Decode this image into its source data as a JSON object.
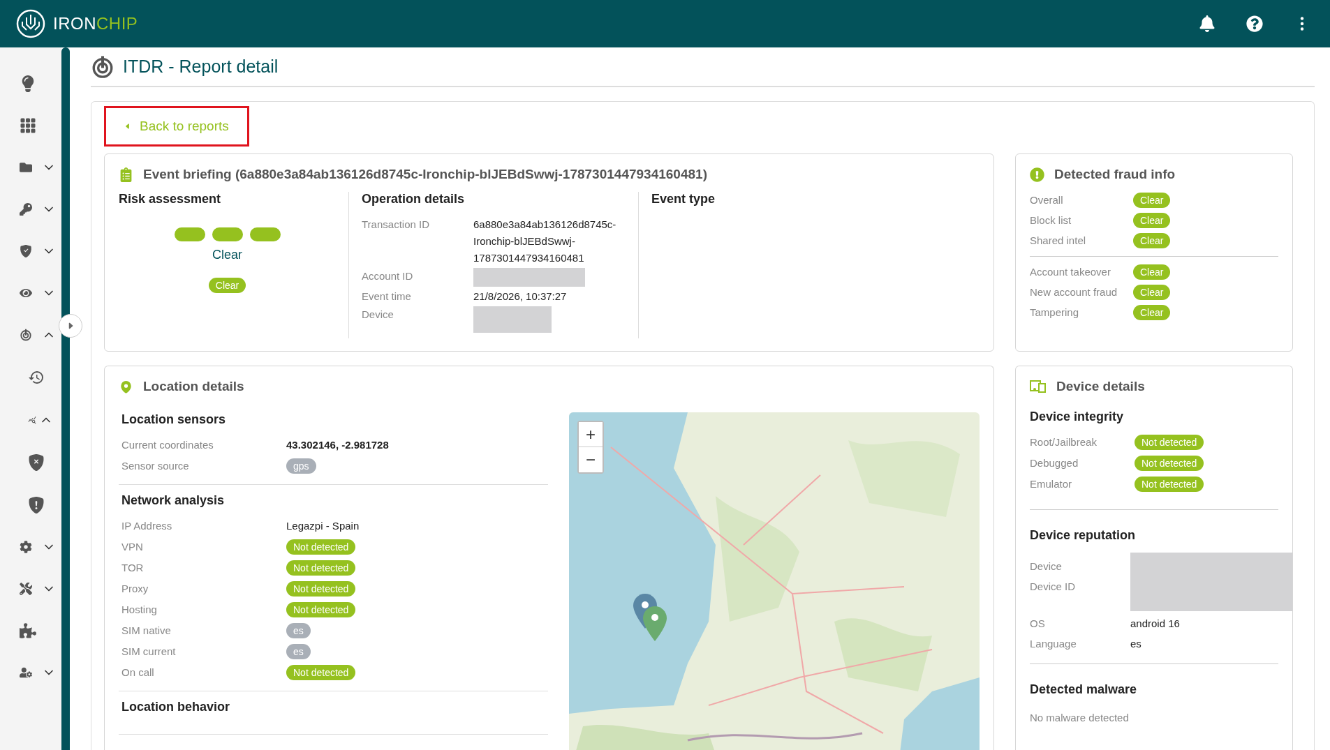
{
  "header": {
    "brand": "IRON",
    "brand_accent": "CHIP"
  },
  "sidebar": {
    "items": [
      {
        "kind": "link"
      },
      {
        "kind": "link"
      },
      {
        "kind": "group",
        "expanded": false
      },
      {
        "kind": "group",
        "expanded": false
      },
      {
        "kind": "group",
        "expanded": false
      },
      {
        "kind": "group",
        "expanded": false
      },
      {
        "kind": "group",
        "expanded": true,
        "children": [
          {
            "kind": "link"
          },
          {
            "kind": "group",
            "expanded": true
          },
          {
            "kind": "link"
          },
          {
            "kind": "link"
          }
        ]
      },
      {
        "kind": "group",
        "expanded": false
      },
      {
        "kind": "group",
        "expanded": false
      },
      {
        "kind": "link"
      },
      {
        "kind": "group",
        "expanded": false
      }
    ]
  },
  "page": {
    "title": "ITDR - Report detail",
    "back_link": "Back to reports"
  },
  "event_briefing": {
    "title": "Event briefing (6a880e3a84ab136126d8745c-Ironchip-blJEBdSwwj-1787301447934160481)",
    "risk": {
      "heading": "Risk assessment",
      "levels": [
        {
          "on": true
        },
        {
          "on": true
        },
        {
          "on": true
        }
      ],
      "level_label": "Clear",
      "badge": "Clear"
    },
    "operation": {
      "heading": "Operation details",
      "rows": [
        {
          "label": "Transaction ID",
          "value": "6a880e3a84ab136126d8745c-Ironchip-blJEBdSwwj-1787301447934160481"
        },
        {
          "label": "Account ID",
          "redacted": true
        },
        {
          "label": "Event time",
          "value": "21/8/2026, 10:37:27"
        },
        {
          "label": "Device",
          "redacted": true
        }
      ]
    },
    "event_type": {
      "heading": "Event type"
    }
  },
  "fraud_info": {
    "title": "Detected fraud info",
    "groups": [
      [
        {
          "label": "Overall",
          "badge": "Clear"
        },
        {
          "label": "Block list",
          "badge": "Clear"
        },
        {
          "label": "Shared intel",
          "badge": "Clear"
        }
      ],
      [
        {
          "label": "Account takeover",
          "badge": "Clear"
        },
        {
          "label": "New account fraud",
          "badge": "Clear"
        },
        {
          "label": "Tampering",
          "badge": "Clear"
        }
      ]
    ]
  },
  "location": {
    "title": "Location details",
    "sections": [
      {
        "heading": "Location sensors",
        "rows": [
          {
            "label": "Current coordinates",
            "kind": "strong",
            "value": "43.302146, -2.981728"
          },
          {
            "label": "Sensor source",
            "kind": "neutral",
            "value": "gps"
          }
        ]
      },
      {
        "heading": "Network analysis",
        "rows": [
          {
            "label": "IP Address",
            "kind": "text",
            "value": "Legazpi - Spain"
          },
          {
            "label": "VPN",
            "kind": "ok",
            "value": "Not detected"
          },
          {
            "label": "TOR",
            "kind": "ok",
            "value": "Not detected"
          },
          {
            "label": "Proxy",
            "kind": "ok",
            "value": "Not detected"
          },
          {
            "label": "Hosting",
            "kind": "ok",
            "value": "Not detected"
          },
          {
            "label": "SIM native",
            "kind": "neutral",
            "value": "es"
          },
          {
            "label": "SIM current",
            "kind": "neutral",
            "value": "es"
          },
          {
            "label": "On call",
            "kind": "ok",
            "value": "Not detected"
          }
        ]
      },
      {
        "heading": "Location behavior"
      }
    ],
    "map": {
      "kind": "picture",
      "zoom_in": "+",
      "zoom_out": "−",
      "markers": [
        {
          "color": "#5a87a5"
        },
        {
          "color": "#6aab6e"
        }
      ]
    }
  },
  "device": {
    "title": "Device details",
    "integrity": {
      "heading": "Device integrity",
      "rows": [
        {
          "label": "Root/Jailbreak",
          "badge": "Not detected"
        },
        {
          "label": "Debugged",
          "badge": "Not detected"
        },
        {
          "label": "Emulator",
          "badge": "Not detected"
        }
      ]
    },
    "reputation": {
      "heading": "Device reputation",
      "redacted_rows": [
        {
          "label": "Device"
        },
        {
          "label": "Device ID"
        }
      ],
      "redacted": true,
      "rows": [
        {
          "label": "OS",
          "value": "android 16"
        },
        {
          "label": "Language",
          "value": "es"
        }
      ]
    },
    "malware": {
      "heading": "Detected malware",
      "text": "No malware detected"
    }
  }
}
